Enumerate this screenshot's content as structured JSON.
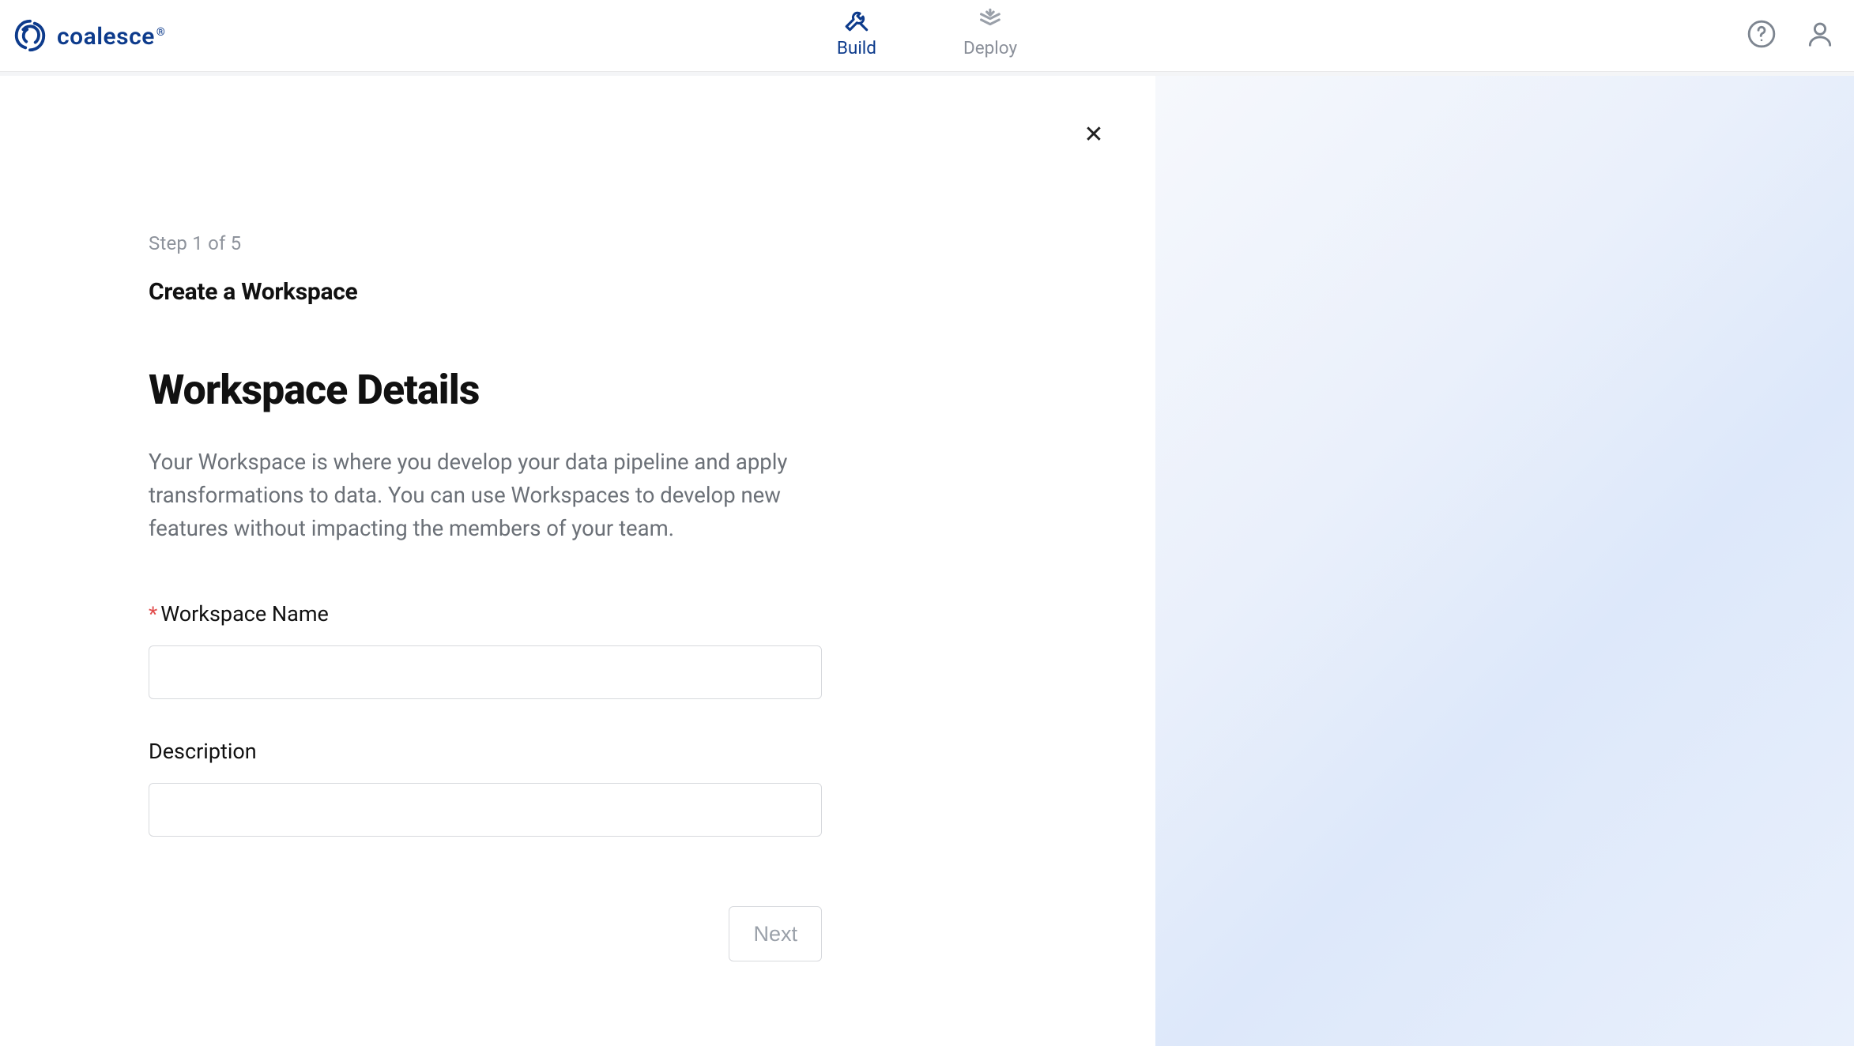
{
  "brand": {
    "name": "coalesce"
  },
  "nav": {
    "build": {
      "label": "Build",
      "active": true
    },
    "deploy": {
      "label": "Deploy",
      "active": false
    }
  },
  "wizard": {
    "step_text": "Step 1 of 5",
    "title": "Create a Workspace",
    "heading": "Workspace Details",
    "description": "Your Workspace is where you develop your data pipeline and apply transformations to data. You can use Workspaces to develop new features without impacting the members of your team.",
    "fields": {
      "name": {
        "label": "Workspace Name",
        "required": true,
        "value": ""
      },
      "description": {
        "label": "Description",
        "required": false,
        "value": ""
      }
    },
    "actions": {
      "next": {
        "label": "Next",
        "enabled": false
      }
    },
    "close_label": "✕"
  },
  "icons": {
    "help": "help-circle-icon",
    "user": "user-icon",
    "build": "tools-icon",
    "deploy": "deploy-icon",
    "logo": "swirl-icon",
    "close": "close-icon"
  },
  "colors": {
    "brand": "#0d3b8c",
    "muted": "#8a8f99",
    "border": "#d7d9dd",
    "required": "#e24d4d"
  }
}
